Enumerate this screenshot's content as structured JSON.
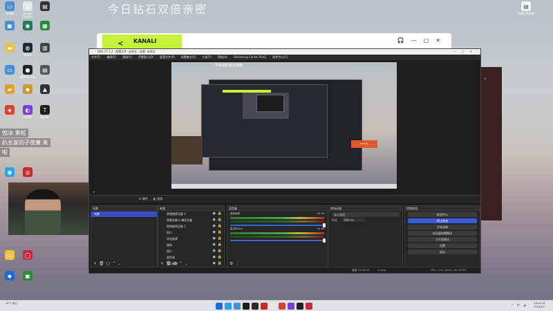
{
  "desktop": {
    "headline": "今日钻石双倍亲密",
    "right_top_icon_label": "新建文本文档",
    "icons": [
      {
        "label": "此电脑",
        "color": "#4a8fd4",
        "glyph": "▭"
      },
      {
        "label": "Google Chrome",
        "color": "#e6e6e6",
        "glyph": "◎"
      },
      {
        "label": "",
        "color": "#333",
        "glyph": "▤"
      },
      {
        "label": "",
        "color": "#4a8fd4",
        "glyph": "▣"
      },
      {
        "label": "",
        "color": "#1f7a5a",
        "glyph": "◉"
      },
      {
        "label": "",
        "color": "#2a8a3a",
        "glyph": "▦"
      },
      {
        "label": "",
        "color": "#e8c24a",
        "glyph": "▬"
      },
      {
        "label": "Steam",
        "color": "#1b2838",
        "glyph": "◍"
      },
      {
        "label": "",
        "color": "#444",
        "glyph": "▥"
      },
      {
        "label": "",
        "color": "#4a8fd4",
        "glyph": "▭"
      },
      {
        "label": "OBS Studio",
        "color": "#222",
        "glyph": "●"
      },
      {
        "label": "",
        "color": "#555",
        "glyph": "▤"
      },
      {
        "label": "",
        "color": "#e0a030",
        "glyph": "▰"
      },
      {
        "label": "",
        "color": "#c99a2e",
        "glyph": "◆"
      },
      {
        "label": "",
        "color": "#333",
        "glyph": "▲"
      },
      {
        "label": "",
        "color": "#d9442e",
        "glyph": "◈"
      },
      {
        "label": "LiveKit",
        "color": "#7a3fd0",
        "glyph": "◐"
      },
      {
        "label": "TapTap",
        "color": "#1f1f1f",
        "glyph": "T"
      },
      {
        "label": "",
        "color": "#2ba3e6",
        "glyph": "◉"
      },
      {
        "label": "",
        "color": "#c42a2a",
        "glyph": "◎"
      },
      {
        "label": "",
        "color": "#f2c23a",
        "glyph": "▭"
      },
      {
        "label": "",
        "color": "#c42a3a",
        "glyph": "◯"
      },
      {
        "label": "",
        "color": "#1f6ad9",
        "glyph": "◆"
      },
      {
        "label": "",
        "color": "#2a8a3a",
        "glyph": "▣"
      }
    ],
    "chat": [
      "悦冰 来啦",
      "扒长家的子夜魔 来",
      "啦"
    ]
  },
  "bg_window": {
    "brand": "KANALI"
  },
  "obs": {
    "title": "OBS 27.1.3 - 配置文件: 未命名 - 场景: 未命名",
    "menu": [
      "文件(F)",
      "编辑(E)",
      "视图(V)",
      "停靠窗口(D)",
      "配置文件(P)",
      "场景集合(S)",
      "工具(T)",
      "帮助(H)",
      "Streaming Center PLUG",
      "插件中心(C)"
    ],
    "preview_inner_heading": "今日钻石双倍亲密",
    "preview_button": "CYPHER_",
    "toolbar": [
      "属性",
      "滤镜"
    ],
    "scene_selector": "",
    "docks": {
      "scenes": {
        "title": "场景",
        "items": [
          "场景"
        ]
      },
      "sources": {
        "title": "来源",
        "items": [
          "视频捕获设备 2",
          "视频采集卡 捕获设备",
          "视频捕获设备 2",
          "窗口",
          "浏览器源",
          "媒体",
          "图片",
          "颜色源",
          "显示捕获"
        ]
      },
      "mixer": {
        "title": "混音器",
        "channels": [
          {
            "name": "桌面音频",
            "value": "-inf dB"
          },
          {
            "name": "麦克风/Aux",
            "value": "-inf dB"
          }
        ]
      },
      "transitions": {
        "title": "转场动画",
        "type": "淡入淡出",
        "duration_label": "时长",
        "duration_value": "300 ms"
      },
      "controls": {
        "title": "控制按钮",
        "buttons": [
          "推流中心",
          "停止推流",
          "开始录制",
          "启动虚拟摄像机",
          "工作室模式",
          "设置",
          "退出"
        ]
      }
    },
    "status": {
      "left": "直播: 00:00:00",
      "middle": "0 kbps",
      "cpu": "CPU: 1.1%, 60.00 / 60.00 FPS"
    }
  },
  "taskbar": {
    "weather": "10°C 多云",
    "time": "14:29:16",
    "date": "2023/4/7",
    "app_colors": [
      "#1f6ad9",
      "#2ba3e6",
      "#4a8fd4",
      "#1b1b1b",
      "#2a2a2a",
      "#c42a2a",
      "#e6e6e6",
      "#d9442e",
      "#7a3fd0",
      "#222",
      "#c42a3a"
    ]
  }
}
